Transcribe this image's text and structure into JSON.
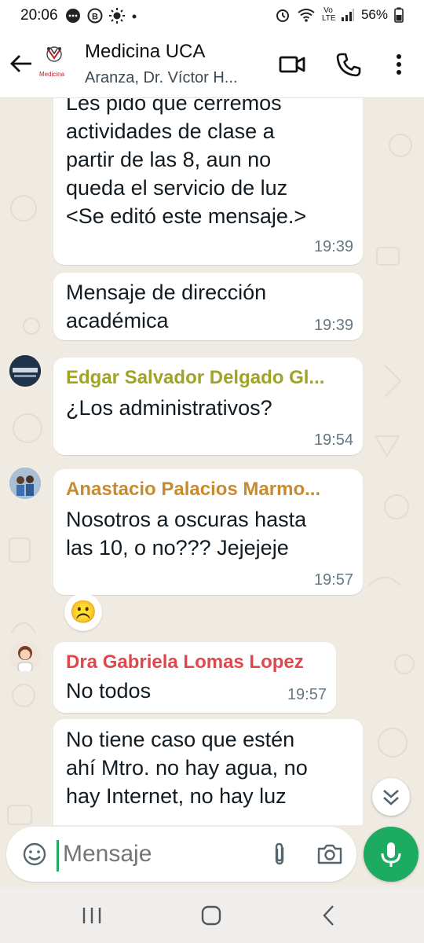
{
  "status_bar": {
    "time": "20:06",
    "battery": "56%",
    "network": "Vo LTE"
  },
  "header": {
    "title": "Medicina UCA",
    "subtitle": "Aranza, Dr. Víctor H...",
    "avatar_text": "Medicina"
  },
  "messages": [
    {
      "sender": "",
      "text": "Les pido que cerremos\nactividades de clase a\npartir de las 8, aun no\nqueda el servicio de luz\n<Se editó este mensaje.>",
      "time": "19:39"
    },
    {
      "sender": "",
      "text": "Mensaje de dirección\nacadémica",
      "time": "19:39"
    },
    {
      "sender": "Edgar Salvador Delgado Gl...",
      "sender_color": "#a0a324",
      "text": "¿Los administrativos?",
      "time": "19:54"
    },
    {
      "sender": "Anastacio Palacios Marmo...",
      "sender_color": "#c98a2e",
      "text": "Nosotros a oscuras hasta\nlas 10, o no??? Jejejeje",
      "time": "19:57",
      "reaction": "☹️"
    },
    {
      "sender": "Dra Gabriela Lomas Lopez",
      "sender_color": "#e0474c",
      "text": "No todos",
      "time": "19:57"
    },
    {
      "sender": "",
      "text": "No tiene caso que estén\nahí Mtro. no hay agua, no\nhay Internet, no hay luz",
      "time": ""
    }
  ],
  "composer": {
    "placeholder": "Mensaje"
  },
  "colors": {
    "accent": "#1daa61",
    "chat_background": "#efeae2"
  },
  "icons": [
    "back-arrow-icon",
    "video-call-icon",
    "phone-icon",
    "more-vert-icon",
    "emoji-icon",
    "attach-icon",
    "camera-icon",
    "mic-icon",
    "double-chevron-down-icon"
  ]
}
